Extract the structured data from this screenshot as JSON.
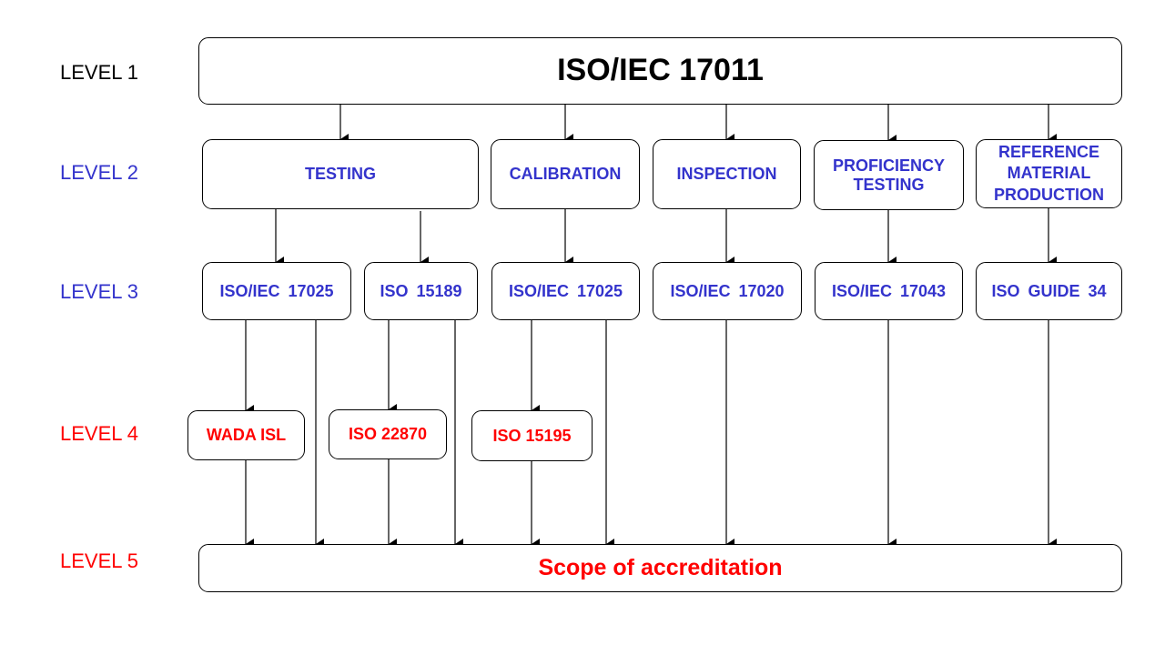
{
  "levels": {
    "l1": "LEVEL 1",
    "l2": "LEVEL 2",
    "l3": "LEVEL 3",
    "l4": "LEVEL 4",
    "l5": "LEVEL 5"
  },
  "level1": {
    "label": "ISO/IEC 17011"
  },
  "level2": [
    {
      "label": "TESTING"
    },
    {
      "label": "CALIBRATION"
    },
    {
      "label": "INSPECTION"
    },
    {
      "label": "PROFICIENCY TESTING"
    },
    {
      "label": "REFERENCE MATERIAL PRODUCTION"
    }
  ],
  "level3": [
    {
      "label": "ISO/IEC 17025"
    },
    {
      "label": "ISO 15189"
    },
    {
      "label": "ISO/IEC 17025"
    },
    {
      "label": "ISO/IEC 17020"
    },
    {
      "label": "ISO/IEC 17043"
    },
    {
      "label": "ISO GUIDE 34"
    }
  ],
  "level4": [
    {
      "label": "WADA ISL"
    },
    {
      "label": "ISO 22870"
    },
    {
      "label": "ISO 15195"
    }
  ],
  "level5": {
    "label": "Scope of accreditation"
  },
  "colors": {
    "level1": "#000000",
    "level2_3": "#3333CC",
    "level4_5": "#FF0000"
  }
}
